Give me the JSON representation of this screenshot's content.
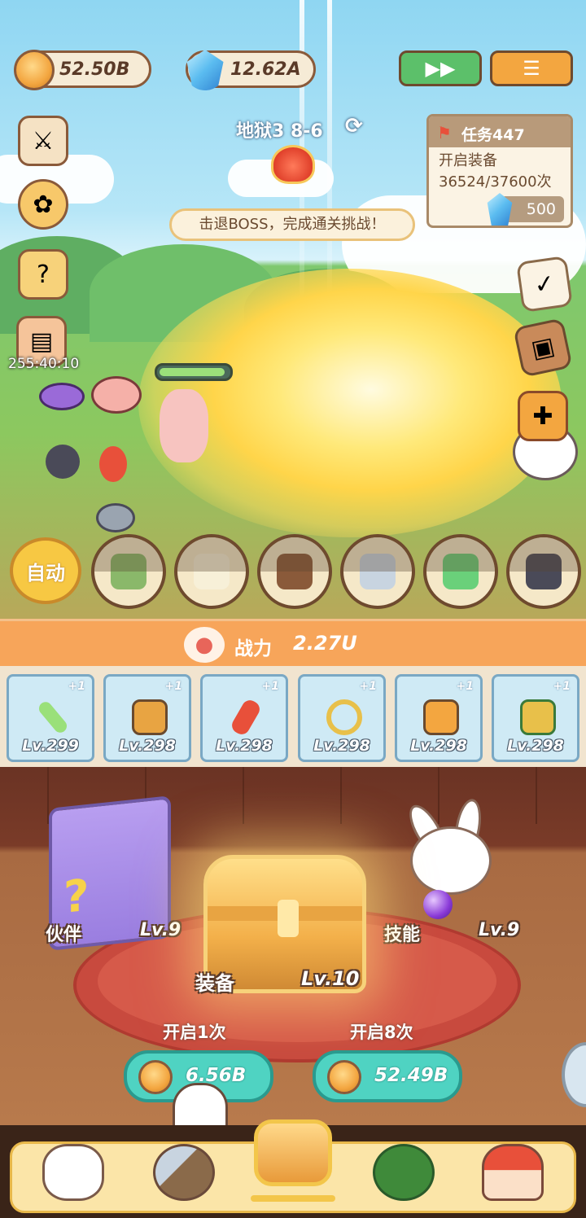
{
  "resources": {
    "coins": "52.50B",
    "gems": "12.62A"
  },
  "top_buttons": {
    "speed_icon": "fast-forward-icon",
    "menu_icon": "menu-list-icon",
    "speed_color": "#5cc06a",
    "menu_color": "#f3a640"
  },
  "stage": {
    "label": "地狱3  8-6"
  },
  "boss_tip": "击退BOSS，完成通关挑战！",
  "quest": {
    "title": "任务447",
    "desc": "开启装备36524/37600次",
    "reward": "500"
  },
  "timer": "255:40:10",
  "battle": {
    "boss_hp_fraction": 0.95
  },
  "skills": {
    "auto_label": "自动",
    "items": [
      {
        "name": "sandwich",
        "cooldown_fraction": 0.5
      },
      {
        "name": "egg",
        "cooldown_fraction": 0.5
      },
      {
        "name": "poop",
        "cooldown_fraction": 0.5
      },
      {
        "name": "tornado",
        "cooldown_fraction": 0.5
      },
      {
        "name": "candy",
        "cooldown_fraction": 0.5
      },
      {
        "name": "penguin",
        "cooldown_fraction": 0.5
      }
    ]
  },
  "power": {
    "label": "战力",
    "value": "2.27U"
  },
  "equipment": [
    {
      "icon": "sword-icon",
      "plus": "+1",
      "level": "Lv.299"
    },
    {
      "icon": "book-icon",
      "plus": "+1",
      "level": "Lv.298"
    },
    {
      "icon": "firework-icon",
      "plus": "+1",
      "level": "Lv.298"
    },
    {
      "icon": "ring-icon",
      "plus": "+1",
      "level": "Lv.298"
    },
    {
      "icon": "shirt-icon",
      "plus": "+1",
      "level": "Lv.298"
    },
    {
      "icon": "boots-icon",
      "plus": "+1",
      "level": "Lv.298"
    }
  ],
  "room": {
    "partner_label": "伙伴",
    "partner_level": "Lv.9",
    "skill_label": "技能",
    "skill_level": "Lv.9",
    "equip_label": "装备",
    "equip_level": "Lv.10"
  },
  "open": {
    "one_label": "开启1次",
    "one_cost": "6.56B",
    "eight_label": "开启8次",
    "eight_cost": "52.49B"
  },
  "nav": {
    "tabs": [
      "cat-tab",
      "weapon-tab",
      "chest-tab",
      "tree-tab",
      "house-tab"
    ],
    "active": "chest-tab"
  }
}
